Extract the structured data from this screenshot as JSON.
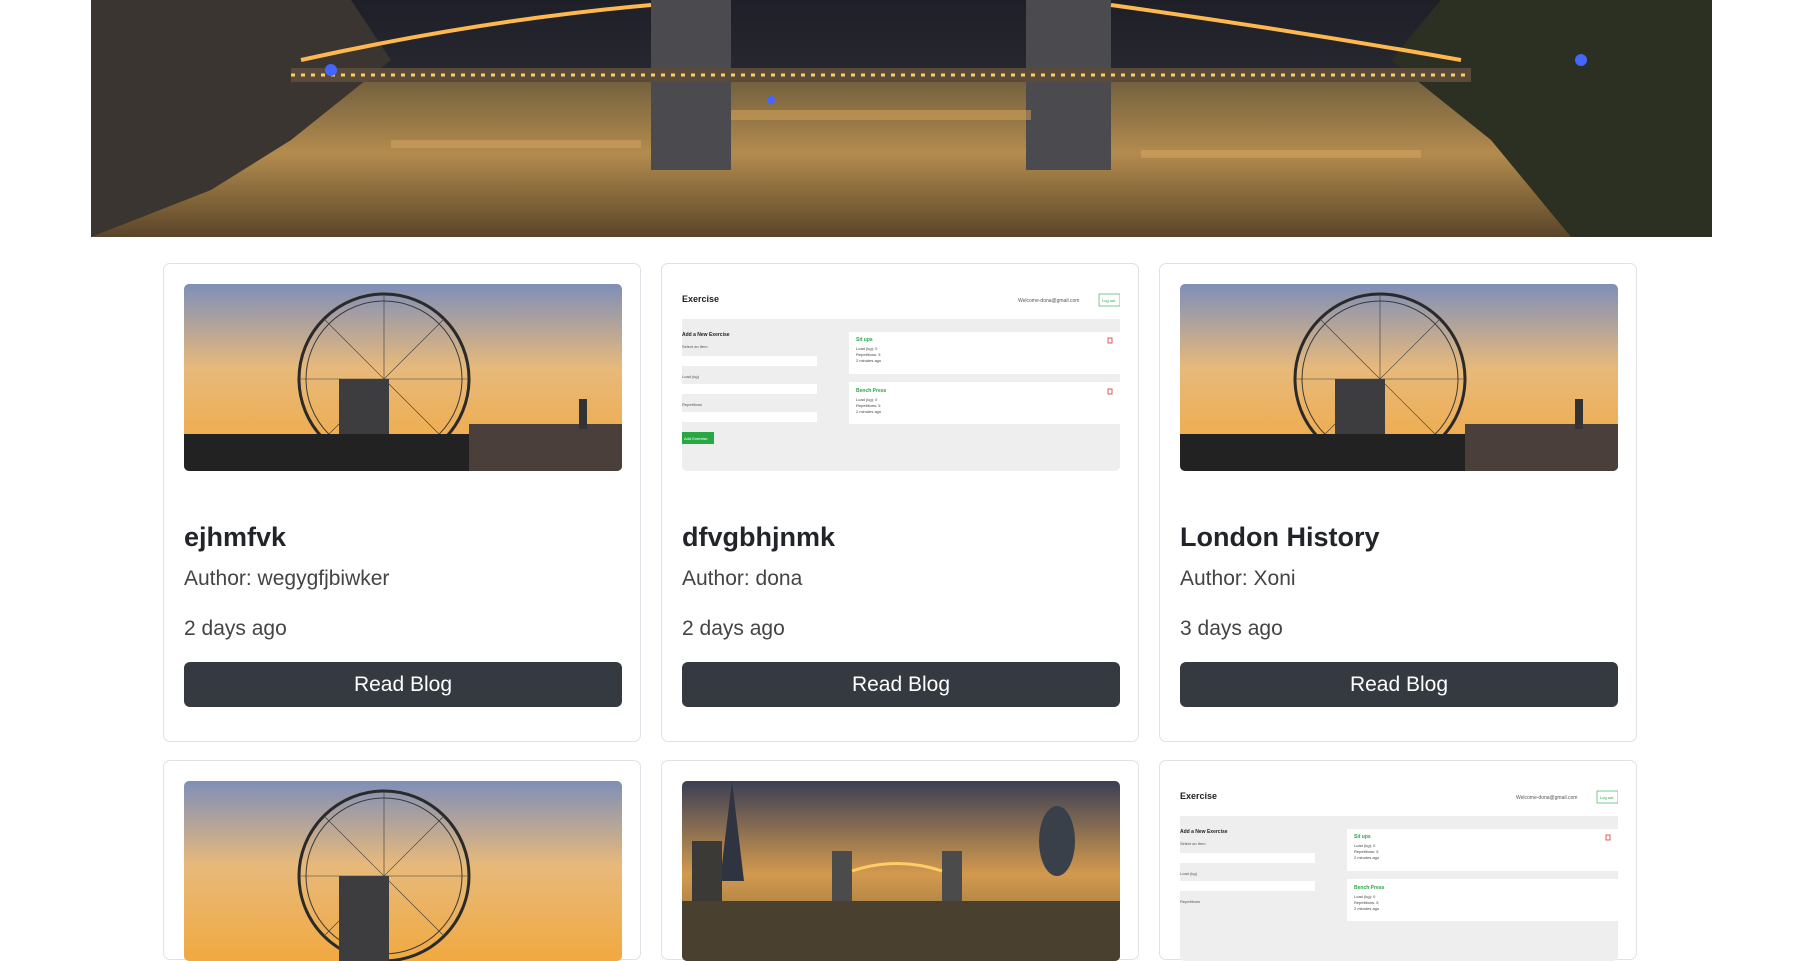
{
  "hero": {
    "image": "tower-bridge-night-photo"
  },
  "colors": {
    "button_bg": "#343a40",
    "button_text": "#ffffff",
    "card_border": "#dee2e6",
    "accent_green": "#28a745"
  },
  "cards": [
    {
      "title": "ejhmfvk",
      "author": "Author: wegygfjbiwker",
      "date": "2 days ago",
      "button": "Read Blog",
      "image": "london-eye-photo"
    },
    {
      "title": "dfvgbhjnmk",
      "author": "Author: dona",
      "date": "2 days ago",
      "button": "Read Blog",
      "image": "exercise-app-screenshot"
    },
    {
      "title": "London History",
      "author": "Author: Xoni",
      "date": "3 days ago",
      "button": "Read Blog",
      "image": "london-eye-photo"
    },
    {
      "image": "london-eye-photo"
    },
    {
      "image": "london-skyline-photo"
    },
    {
      "image": "exercise-app-screenshot"
    }
  ],
  "exercise_thumb": {
    "brand": "Exercise",
    "email": "Welcome-dona@gmail.com",
    "logout": "Log out",
    "form_title": "Add a New Exercise",
    "field1": "Select an Item",
    "field2": "Load (kg)",
    "field3": "Repetitions",
    "add_button": "Add Exercise",
    "item1_title": "Sit ups",
    "item1_lines": [
      "Load (kg): 0",
      "Repetitions: 5",
      "2 minutes ago"
    ],
    "item2_title": "Bench Press",
    "item2_lines": [
      "Load (kg): 0",
      "Repetitions: 5",
      "2 minutes ago"
    ]
  }
}
